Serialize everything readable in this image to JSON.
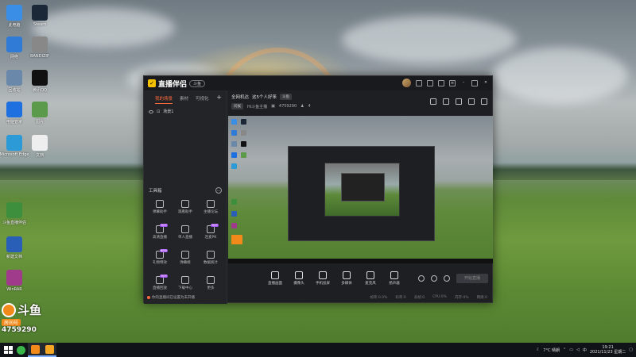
{
  "desktop": {
    "icons": [
      {
        "label": "此电脑",
        "icon": "computer-icon",
        "color": "#3a8ee6"
      },
      {
        "label": "Steam",
        "icon": "steam-icon",
        "color": "#1b2838"
      },
      {
        "label": "网络",
        "icon": "network-icon",
        "color": "#2f7bd6"
      },
      {
        "label": "BANDIZIP",
        "icon": "bandizip-icon",
        "color": "#888888"
      },
      {
        "label": "回收站",
        "icon": "recycle-bin-icon",
        "color": "#6a88aa"
      },
      {
        "label": "腾讯QQ",
        "icon": "qq-icon",
        "color": "#111111"
      },
      {
        "label": "电脑管家",
        "icon": "shield-icon",
        "color": "#1e6fe0"
      },
      {
        "label": "图片",
        "icon": "image-icon",
        "color": "#5a9a4a"
      },
      {
        "label": "Microsoft Edge",
        "icon": "edge-icon",
        "color": "#2b9ad6"
      },
      {
        "label": "文档",
        "icon": "file-icon",
        "color": "#eeeeee"
      },
      {
        "label": "斗鱼直播伴侣",
        "icon": "douyu-icon",
        "color": "#3d8f3d"
      },
      {
        "label": "新建文档",
        "icon": "word-icon",
        "color": "#2a5fb7"
      },
      {
        "label": "WinRAR",
        "icon": "winrar-icon",
        "color": "#a03a8a"
      }
    ]
  },
  "app": {
    "name": "直播伴侣",
    "badge": "斗鱼",
    "tabs": [
      "我的场景",
      "素材",
      "可视化"
    ],
    "scene_label": "场景1",
    "tools_title": "工具箱",
    "tools": [
      {
        "label": "弹幕助手",
        "icon": "danmaku-icon",
        "hot": ""
      },
      {
        "label": "观看助手",
        "icon": "viewer-icon",
        "hot": ""
      },
      {
        "label": "主播论坛",
        "icon": "forum-icon",
        "hot": ""
      },
      {
        "label": "高清直播",
        "icon": "hd-icon",
        "hot": "HOT"
      },
      {
        "label": "单人直播",
        "icon": "download-icon",
        "hot": ""
      },
      {
        "label": "连麦PK",
        "icon": "pk-icon",
        "hot": "HOT"
      },
      {
        "label": "礼物特效",
        "icon": "gift-icon",
        "hot": "NEW"
      },
      {
        "label": "弹幕姬",
        "icon": "tv-icon",
        "hot": ""
      },
      {
        "label": "数据统计",
        "icon": "stats-icon",
        "hot": ""
      },
      {
        "label": "直播回放",
        "icon": "replay-icon",
        "hot": "HOT"
      },
      {
        "label": "下载中心",
        "icon": "download2-icon",
        "hot": ""
      },
      {
        "label": "更多",
        "icon": "more-icon",
        "hot": ""
      }
    ],
    "notice": "你的直播间已设置为未开播",
    "room": {
      "category": "全网机达",
      "title": "这5个人好笨",
      "tag": "斗鱼",
      "subtag": "问候",
      "owner": "Hi斗鱼主播",
      "room_id": "4759290",
      "fans": "4"
    },
    "controls": [
      {
        "label": "直播画面",
        "icon": "screen-icon"
      },
      {
        "label": "摄像头",
        "icon": "camera-icon"
      },
      {
        "label": "手机投屏",
        "icon": "phone-cast-icon"
      },
      {
        "label": "多媒体",
        "icon": "media-icon"
      },
      {
        "label": "麦克风",
        "icon": "mic-icon"
      },
      {
        "label": "扬声器",
        "icon": "speaker-icon"
      }
    ],
    "live_button": "开始直播",
    "status": [
      "帧率:0.0%",
      "码率:0",
      "丢帧:0",
      "CPU:0%",
      "内存:0%",
      "网络:0"
    ]
  },
  "watermark": {
    "brand": "斗鱼",
    "sub": "房间号",
    "room": "4759290"
  },
  "taskbar": {
    "weather": "7°C 晴朗",
    "lang": "中",
    "time": "19:21",
    "date": "2021/11/23 星期二"
  }
}
